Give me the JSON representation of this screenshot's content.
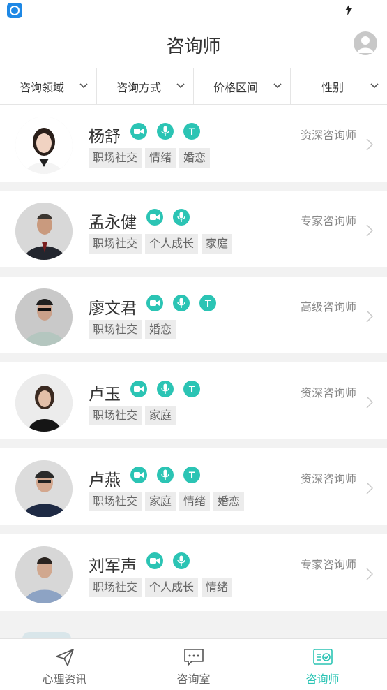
{
  "status_bar": {
    "app_icon": "app-logo-icon",
    "charging_icon": "charging-bolt-icon"
  },
  "header": {
    "title": "咨询师",
    "profile_icon": "user-avatar-icon"
  },
  "filters": [
    {
      "label": "咨询领域"
    },
    {
      "label": "咨询方式"
    },
    {
      "label": "价格区间"
    },
    {
      "label": "性别"
    }
  ],
  "counselors": [
    {
      "name": "杨舒",
      "level": "资深咨询师",
      "modes": [
        "video",
        "voice",
        "text"
      ],
      "tags": [
        "职场社交",
        "情绪",
        "婚恋"
      ]
    },
    {
      "name": "孟永健",
      "level": "专家咨询师",
      "modes": [
        "video",
        "voice"
      ],
      "tags": [
        "职场社交",
        "个人成长",
        "家庭"
      ]
    },
    {
      "name": "廖文君",
      "level": "高级咨询师",
      "modes": [
        "video",
        "voice",
        "text"
      ],
      "tags": [
        "职场社交",
        "婚恋"
      ]
    },
    {
      "name": "卢玉",
      "level": "资深咨询师",
      "modes": [
        "video",
        "voice",
        "text"
      ],
      "tags": [
        "职场社交",
        "家庭"
      ]
    },
    {
      "name": "卢燕",
      "level": "资深咨询师",
      "modes": [
        "video",
        "voice",
        "text"
      ],
      "tags": [
        "职场社交",
        "家庭",
        "情绪",
        "婚恋"
      ]
    },
    {
      "name": "刘军声",
      "level": "专家咨询师",
      "modes": [
        "video",
        "voice"
      ],
      "tags": [
        "职场社交",
        "个人成长",
        "情绪"
      ]
    }
  ],
  "mode_text_glyph": "T",
  "tabs": [
    {
      "label": "心理资讯",
      "icon": "paper-plane-icon",
      "active": false
    },
    {
      "label": "咨询室",
      "icon": "chat-bubble-icon",
      "active": false
    },
    {
      "label": "咨询师",
      "icon": "counselor-list-icon",
      "active": true
    }
  ],
  "colors": {
    "accent": "#2bc4b4",
    "tag_bg": "#ececec",
    "background": "#f2f2f2"
  }
}
